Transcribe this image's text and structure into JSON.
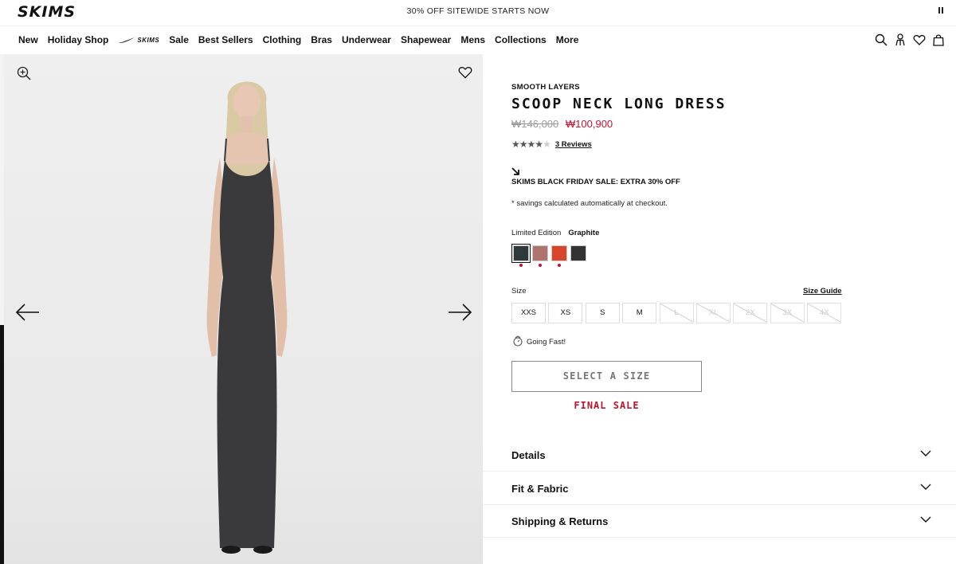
{
  "brand": {
    "logo": "SKIMS"
  },
  "promo": {
    "text": "30% OFF SITEWIDE STARTS NOW"
  },
  "nav": {
    "items": [
      "New",
      "Holiday Shop"
    ],
    "partner_label": "SKIMS",
    "items_after": [
      "Sale",
      "Best Sellers",
      "Clothing",
      "Bras",
      "Underwear",
      "Shapewear",
      "Mens",
      "Collections",
      "More"
    ]
  },
  "product": {
    "collection": "SMOOTH LAYERS",
    "title": "SCOOP NECK LONG DRESS",
    "original_price": "₩146,000",
    "sale_price": "₩100,900",
    "rating": 4.5,
    "reviews_label": "3 Reviews",
    "sale_banner": "SKIMS BLACK FRIDAY SALE: EXTRA 30% OFF",
    "savings_note": "* savings calculated automatically at checkout.",
    "edition_label": "Limited Edition",
    "color_name": "Graphite",
    "swatches": [
      {
        "color": "#2f3a3d",
        "selected": true,
        "sale": true
      },
      {
        "color": "#b0746e",
        "selected": false,
        "sale": true
      },
      {
        "color": "#d9452b",
        "selected": false,
        "sale": true
      },
      {
        "color": "#333333",
        "selected": false,
        "sale": false
      }
    ],
    "size_label": "Size",
    "size_guide": "Size Guide",
    "sizes": [
      {
        "label": "XXS",
        "available": true
      },
      {
        "label": "XS",
        "available": true
      },
      {
        "label": "S",
        "available": true
      },
      {
        "label": "M",
        "available": true
      },
      {
        "label": "L",
        "available": false
      },
      {
        "label": "XL",
        "available": false
      },
      {
        "label": "2X",
        "available": false
      },
      {
        "label": "3X",
        "available": false
      },
      {
        "label": "4X",
        "available": false
      }
    ],
    "going_fast": "Going Fast!",
    "select_button": "SELECT A SIZE",
    "final_sale": "FINAL SALE"
  },
  "accordions": [
    "Details",
    "Fit & Fabric",
    "Shipping & Returns"
  ],
  "colors": {
    "sale_red": "#c4122f",
    "text": "#111111"
  }
}
